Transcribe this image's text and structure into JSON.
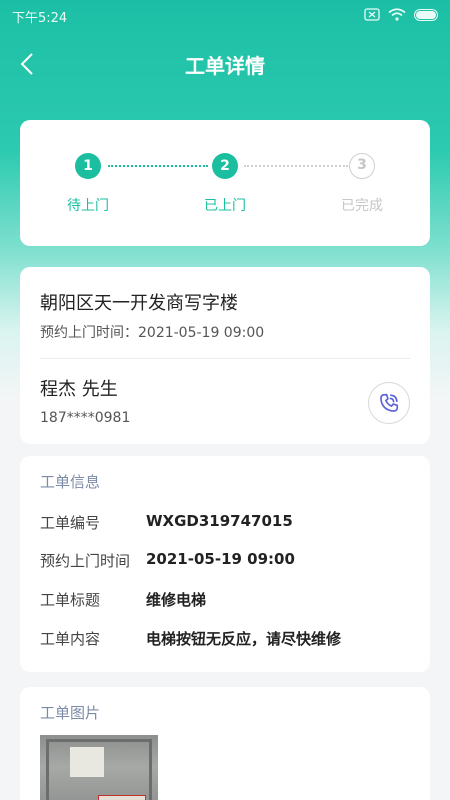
{
  "status_bar": {
    "time": "下午5:24"
  },
  "nav": {
    "title": "工单详情"
  },
  "steps": [
    {
      "number": "1",
      "label": "待上门",
      "state": "done"
    },
    {
      "number": "2",
      "label": "已上门",
      "state": "done"
    },
    {
      "number": "3",
      "label": "已完成",
      "state": "todo"
    }
  ],
  "address_card": {
    "title": "朝阳区天一开发商写字楼",
    "appointment": "预约上门时间：2021-05-19 09:00",
    "contact_name": "程杰 先生",
    "contact_phone": "187****0981"
  },
  "info_card": {
    "section_title": "工单信息",
    "rows": [
      {
        "key": "工单编号",
        "value": "WXGD319747015"
      },
      {
        "key": "预约上门时间",
        "value": "2021-05-19 09:00"
      },
      {
        "key": "工单标题",
        "value": "维修电梯"
      },
      {
        "key": "工单内容",
        "value": "电梯按钮无反应，请尽快维修"
      }
    ]
  },
  "photo_card": {
    "section_title": "工单图片"
  },
  "colors": {
    "accent": "#1bbf9f",
    "call_icon": "#5a64d8",
    "section_title": "#7c8ba8"
  }
}
